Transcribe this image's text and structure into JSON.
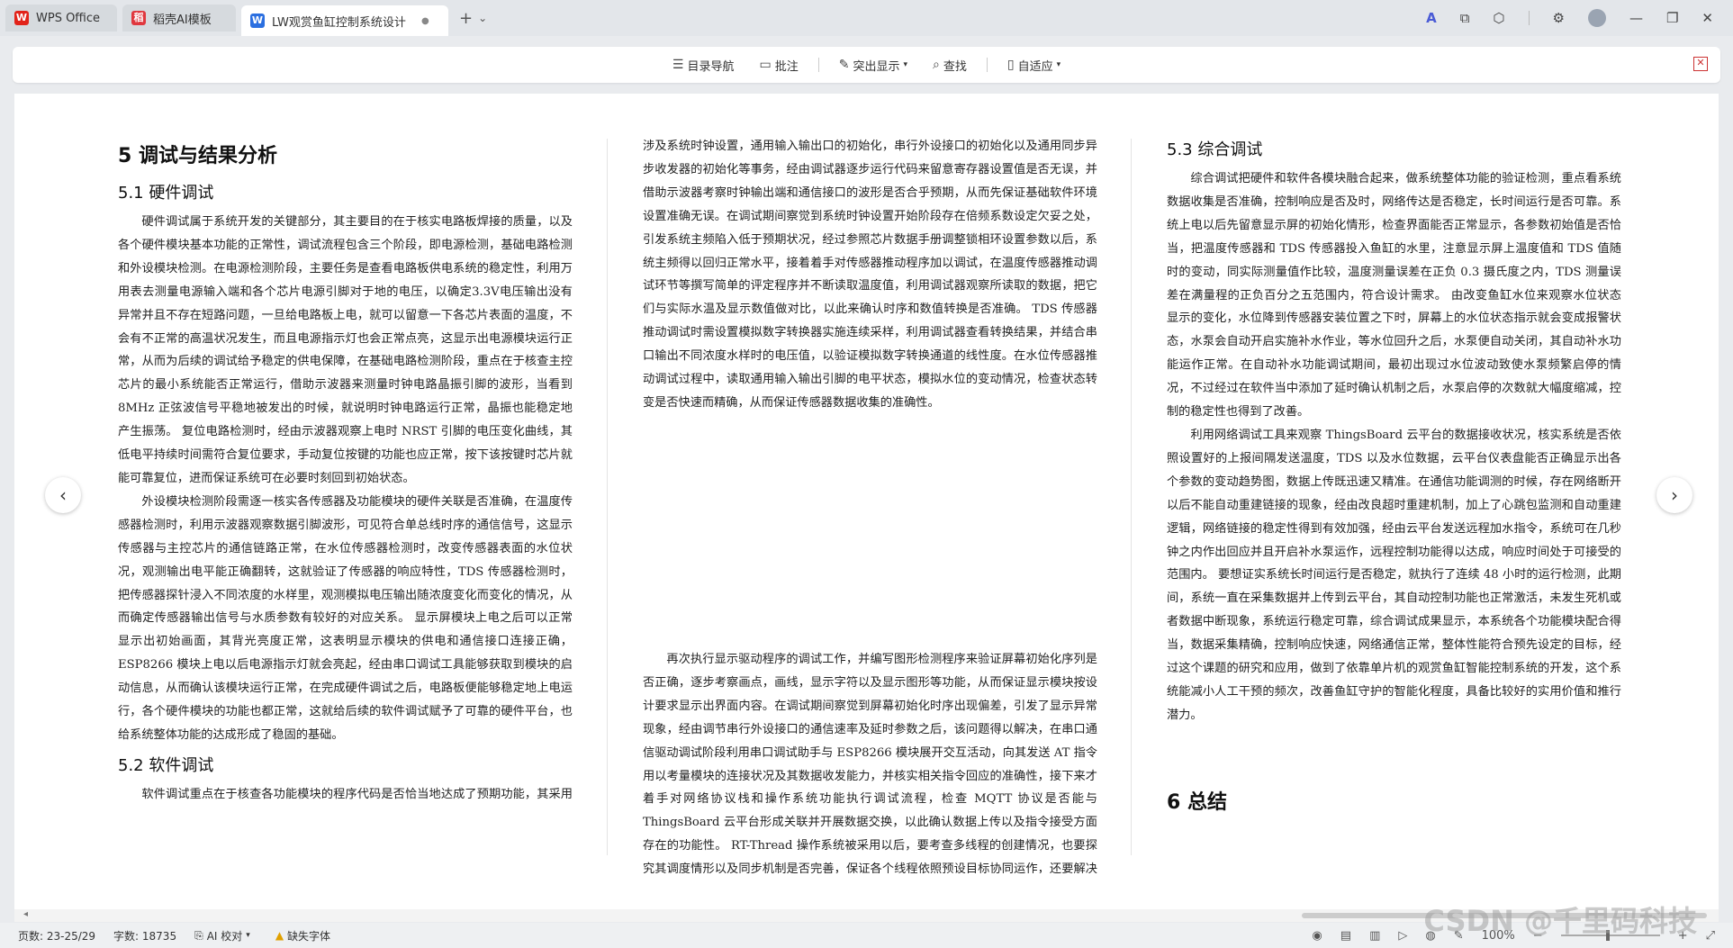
{
  "tabs": [
    {
      "label": "WPS Office",
      "icon": "wps-logo-icon",
      "color": "#e2231a"
    },
    {
      "label": "稻壳AI模板",
      "icon": "docer-logo-icon",
      "color": "#e0373e"
    },
    {
      "label": "LW观赏鱼缸控制系统设计.d",
      "icon": "word-doc-icon",
      "color": "#2b6fe0"
    }
  ],
  "toolbar": {
    "toc": "目录导航",
    "comment": "批注",
    "highlight": "突出显示",
    "find": "查找",
    "fit": "自适应"
  },
  "doc": {
    "h_ch5": "5  调试与结果分析",
    "h_51": "5.1  硬件调试",
    "p_51a": "硬件调试属于系统开发的关键部分，其主要目的在于核实电路板焊接的质量，以及各个硬件模块基本功能的正常性，调试流程包含三个阶段，即电源检测，基础电路检测和外设模块检测。在电源检测阶段，主要任务是查看电路板供电系统的稳定性，利用万用表去测量电源输入端和各个芯片电源引脚对于地的电压，以确定3.3V电压输出没有异常并且不存在短路问题，一旦给电路板上电，就可以留意一下各芯片表面的温度，不会有不正常的高温状况发生，而且电源指示灯也会正常点亮，这显示出电源模块运行正常，从而为后续的调试给予稳定的供电保障，在基础电路检测阶段，重点在于核查主控芯片的最小系统能否正常运行，借助示波器来测量时钟电路晶振引脚的波形，当看到 8MHz 正弦波信号平稳地被发出的时候，就说明时钟电路运行正常，晶振也能稳定地产生振荡。 复位电路检测时，经由示波器观察上电时 NRST 引脚的电压变化曲线，其低电平持续时间需符合复位要求，手动复位按键的功能也应正常，按下该按键时芯片就能可靠复位，进而保证系统可在必要时刻回到初始状态。",
    "p_51b": "外设模块检测阶段需逐一核实各传感器及功能模块的硬件关联是否准确，在温度传感器检测时，利用示波器观察数据引脚波形，可见符合单总线时序的通信信号，这显示传感器与主控芯片的通信链路正常，在水位传感器检测时，改变传感器表面的水位状况，观测输出电平能正确翻转，这就验证了传感器的响应特性，TDS 传感器检测时，把传感器探针浸入不同浓度的水样里，观测模拟电压输出随浓度变化而变化的情况，从而确定传感器输出信号与水质参数有较好的对应关系。 显示屏模块上电之后可以正常显示出初始画面，其背光亮度正常，这表明显示模块的供电和通信接口连接正确，ESP8266 模块上电以后电源指示灯就会亮起，经由串口调试工具能够获取到模块的启动信息，从而确认该模块运行正常，在完成硬件调试之后，电路板便能够稳定地上电运行，各个硬件模块的功能也都正常，这就给后续的软件调试赋予了可靠的硬件平台，也给系统整体功能的达成形成了稳固的基础。",
    "h_52": "5.2  软件调试",
    "p_52a": "软件调试重点在于核查各功能模块的程序代码是否恰当地达成了预期功能，其采用分模块，分阶段的调试策略展开，在此之前先执行基础软件平台的调试，涉及系统时钟设置，通用输入输出口的初始化，串行外设接口的初始化以及通用同步异步收发器的初始化等事务，经由调试器逐步运行代码来留意寄存器设置值是否无误，并借助示波器考察时钟输出端和通信接口的波形是否合乎预期，从而先保证基础软件环境设置准确无误。在调试期间察觉到系统时钟设置开始阶段存在倍频系数设定欠妥之处，引发系统主频陷入低于预期状况，经过参照芯片数据手册调整锁相环设置参数以后，系统主频得以回归正常水平，接着着手对传感器推动程序加以调试，在温度传感器推动调试环节等撰写简单的评定程序并不断读取温度值，利用调试器观察所读取的数据，把它们与实际水温及显示数值做对比，以此来确认时序和数值转换是否准确。 TDS 传感器推动调试时需设置模拟数字转换器实施连续采样，利用调试器查看转换结果，并结合串口输出不同浓度水样时的电压值，以验证模拟数字转换通道的线性度。在水位传感器推动调试过程中，读取通用输入输出引脚的电平状态，模拟水位的变动情况，检查状态转变是否快速而精确，从而保证传感器数据收集的准确性。",
    "p_52b": "再次执行显示驱动程序的调试工作，并编写图形检测程序来验证屏幕初始化序列是否正确，逐步考察画点，画线，显示字符以及显示图形等功能，从而保证显示模块按设计要求显示出界面内容。在调试期间察觉到屏幕初始化时序出现偏差，引发了显示异常现象，经由调节串行外设接口的通信速率及延时参数之后，该问题得以解决，在串口通信驱动调试阶段利用串口调试助手与 ESP8266 模块展开交互活动，向其发送 AT 指令用以考量模块的连接状况及其数据收发能力，并核实相关指令回应的准确性，接下来才着手对网络协议栈和操作系统功能执行调试流程，检查 MQTT 协议是否能与 ThingsBoard 云平台形成关联并开展数据交换，以此确认数据上传以及指令接受方面存在的功能性。 RT-Thread 操作系统被采用以后，要考查多线程的创建情况，也要探究其调度情形以及同步机制是否完善，保证各个线程依照预设目标协同运作，还要解决好资源访问时可能出现的争抢问题。在操作系统相关调试的时候，碰上因为线程栈空间划分短缺而导致系统无法正常运行这种情况，于是便增扩大该空间，改良相关线程的任务安排，如此一来就把先前提及的故障给排除掉了，软件调试过程所找出的各类问题都得细致分析后再加以改正，这样一来，各个模块的功能才得以符合预先规划的目的，进而为接下来要做的系统综合调试工作构筑稳固根基。",
    "h_53": "5.3  综合调试",
    "p_53a": "综合调试把硬件和软件各模块融合起来，做系统整体功能的验证检测，重点看系统数据收集是否准确，控制响应是否及时，网络传达是否稳定，长时间运行是否可靠。系统上电以后先留意显示屏的初始化情形，检查界面能否正常显示，各参数初始值是否恰当，把温度传感器和 TDS 传感器投入鱼缸的水里，注意显示屏上温度值和 TDS 值随时的变动，同实际测量值作比较，温度测量误差在正负 0.3 摄氏度之内，TDS 测量误差在满量程的正负百分之五范围内，符合设计需求。 由改变鱼缸水位来观察水位状态显示的变化，水位降到传感器安装位置之下时，屏幕上的水位状态指示就会变成报警状态，水泵会自动开启实施补水作业，等水位回升之后，水泵便自动关闭，其自动补水功能运作正常。在自动补水功能调试期间，最初出现过水位波动致使水泵频繁启停的情况，不过经过在软件当中添加了延时确认机制之后，水泵启停的次数就大幅度缩减，控制的稳定性也得到了改善。",
    "p_53b": "利用网络调试工具来观察 ThingsBoard 云平台的数据接收状况，核实系统是否依照设置好的上报间隔发送温度，TDS 以及水位数据，云平台仪表盘能否正确显示出各个参数的变动趋势图，数据上传既迅速又精准。在通信功能调测的时候，存在网络断开以后不能自动重建链接的现象，经由改良超时重建机制，加上了心跳包监测和自动重建逻辑，网络链接的稳定性得到有效加强，经由云平台发送远程加水指令，系统可在几秒钟之内作出回应并且开启补水泵运作，远程控制功能得以达成，响应时间处于可接受的范围内。 要想证实系统长时间运行是否稳定，就执行了连续 48 小时的运行检测，此期间，系统一直在采集数据并上传到云平台，其自动控制功能也正常激活，未发生死机或者数据中断现象，系统运行稳定可靠，综合调试成果显示，本系统各个功能模块配合得当，数据采集精确，控制响应快速，网络通信正常，整体性能符合预先设定的目标，经过这个课题的研究和应用，做到了依靠单片机的观赏鱼缸智能控制系统的开发，这个系统能减小人工干预的频次，改善鱼缸守护的智能化程度，具备比较好的实用价值和推行潜力。",
    "h_ch6": "6  总结"
  },
  "status": {
    "pages": "页数: 23-25/29",
    "words": "字数: 18735",
    "ai_check": "AI 校对",
    "missing_font": "缺失字体",
    "zoom": "100%"
  },
  "watermark": "CSDN @千里码科技"
}
